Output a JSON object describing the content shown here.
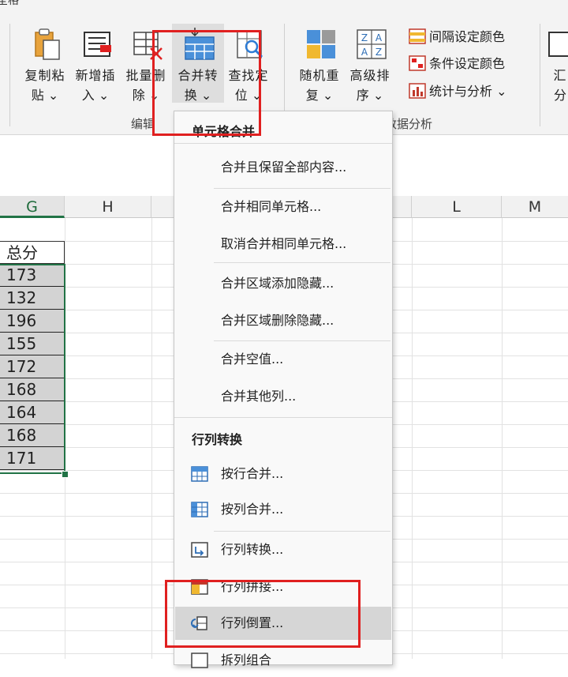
{
  "ribbon": {
    "tab_fragment": "全格",
    "buttons": [
      {
        "line1": "复制粘",
        "line2": "贴 ⌄",
        "icon": "clipboard-icon"
      },
      {
        "line1": "新增插",
        "line2": "入 ⌄",
        "icon": "insert-rows-icon"
      },
      {
        "line1": "批量删",
        "line2": "除 ⌄",
        "icon": "batch-delete-icon"
      },
      {
        "line1": "合并转",
        "line2": "换 ⌄",
        "icon": "merge-convert-icon"
      },
      {
        "line1": "查找定",
        "line2": "位 ⌄",
        "icon": "find-locate-icon"
      },
      {
        "line1": "随机重",
        "line2": "复 ⌄",
        "icon": "random-repeat-icon"
      },
      {
        "line1": "高级排",
        "line2": "序 ⌄",
        "icon": "advanced-sort-icon"
      },
      {
        "line1": "汇",
        "line2": "分",
        "icon": "summary-icon"
      }
    ],
    "small_items": [
      {
        "label": "间隔设定颜色",
        "icon": "interval-color-icon"
      },
      {
        "label": "条件设定颜色",
        "icon": "condition-color-icon"
      },
      {
        "label": "统计与分析 ⌄",
        "icon": "statistics-icon"
      }
    ],
    "group_edit": "编辑",
    "group_data_analysis": "数据分析"
  },
  "sheet": {
    "columns": [
      {
        "label": "G",
        "active": true
      },
      {
        "label": "H",
        "active": false
      },
      {
        "label": "L",
        "active": false
      },
      {
        "label": "M",
        "active": false
      }
    ],
    "header_cell": "总分",
    "values": [
      "173",
      "132",
      "196",
      "155",
      "172",
      "168",
      "164",
      "168",
      "171"
    ]
  },
  "dropdown": {
    "section1_title": "单元格合并",
    "section1_items": [
      "合并且保留全部内容...",
      "合并相同单元格...",
      "取消合并相同单元格...",
      "合并区域添加隐藏...",
      "合并区域删除隐藏...",
      "合并空值...",
      "合并其他列..."
    ],
    "section2_title": "行列转换",
    "section2_items": [
      {
        "label": "按行合并...",
        "icon": "merge-by-row-icon"
      },
      {
        "label": "按列合并...",
        "icon": "merge-by-column-icon"
      },
      {
        "label": "行列转换...",
        "icon": "row-col-convert-icon"
      },
      {
        "label": "行列拼接...",
        "icon": "row-col-join-icon"
      },
      {
        "label": "行列倒置...",
        "icon": "row-col-reverse-icon"
      },
      {
        "label": "拆列组合",
        "icon": "split-column-icon"
      }
    ]
  },
  "colors": {
    "highlight_red": "#e02020",
    "excel_green": "#217346",
    "selected_fill": "#d3d3d3"
  }
}
